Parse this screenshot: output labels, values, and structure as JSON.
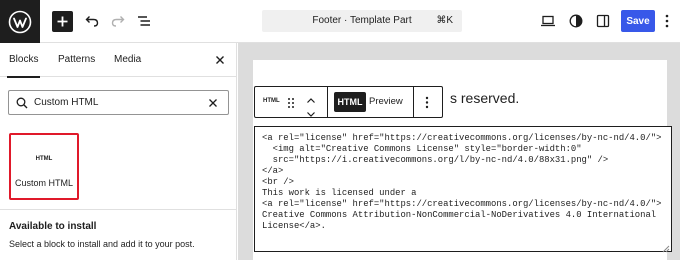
{
  "topbar": {
    "document_title": "Footer · Template Part",
    "shortcut": "⌘K",
    "save_label": "Save"
  },
  "sidebar": {
    "tabs": [
      {
        "label": "Blocks",
        "active": true
      },
      {
        "label": "Patterns",
        "active": false
      },
      {
        "label": "Media",
        "active": false
      }
    ],
    "search": {
      "value": "Custom HTML"
    },
    "result": {
      "icon_text": "HTML",
      "label": "Custom HTML"
    },
    "available": {
      "title": "Available to install",
      "description": "Select a block to install and add it to your post."
    }
  },
  "canvas": {
    "partial_text": "s reserved.",
    "toolbar": {
      "block_icon_text": "HTML",
      "html_tab": "HTML",
      "preview_tab": "Preview"
    },
    "code_lines": [
      "<a rel=\"license\" href=\"https://creativecommons.org/licenses/by-nc-nd/4.0/\">",
      "  <img alt=\"Creative Commons License\" style=\"border-width:0\"",
      "  src=\"https://i.creativecommons.org/l/by-nc-nd/4.0/88x31.png\" />",
      "</a>",
      "<br />",
      "This work is licensed under a",
      "<a rel=\"license\" href=\"https://creativecommons.org/licenses/by-nc-nd/4.0/\">",
      "Creative Commons Attribution-NonCommercial-NoDerivatives 4.0 International",
      "License</a>."
    ]
  },
  "colors": {
    "accent": "#3858e9",
    "highlight": "#e0192a",
    "dark": "#1e1e1e"
  }
}
